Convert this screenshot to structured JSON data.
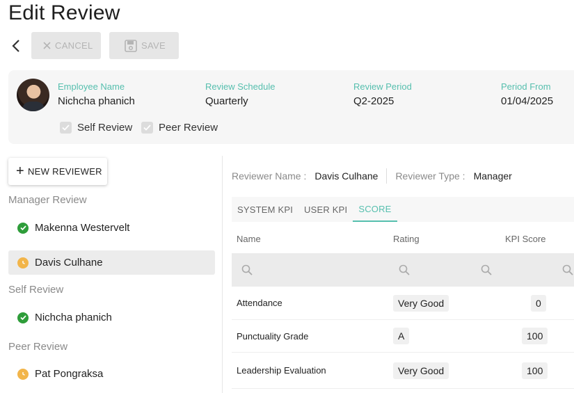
{
  "page": {
    "title": "Edit Review"
  },
  "toolbar": {
    "cancel_label": "CANCEL",
    "save_label": "SAVE"
  },
  "employee": {
    "name_label": "Employee Name",
    "name": "Nichcha phanich",
    "schedule_label": "Review Schedule",
    "schedule": "Quarterly",
    "period_label": "Review Period",
    "period": "Q2-2025",
    "from_label": "Period From",
    "from": "01/04/2025",
    "self_review_label": "Self Review",
    "peer_review_label": "Peer Review"
  },
  "reviewers": {
    "new_button_label": "NEW REVIEWER",
    "groups": [
      {
        "label": "Manager Review",
        "items": [
          {
            "name": "Makenna Westervelt",
            "status": "done"
          },
          {
            "name": "Davis Culhane",
            "status": "pending",
            "selected": true
          }
        ]
      },
      {
        "label": "Self Review",
        "items": [
          {
            "name": "Nichcha phanich",
            "status": "done"
          }
        ]
      },
      {
        "label": "Peer Review",
        "items": [
          {
            "name": "Pat Pongraksa",
            "status": "pending"
          }
        ]
      }
    ]
  },
  "detail": {
    "reviewer_name_label": "Reviewer Name :",
    "reviewer_name": "Davis Culhane",
    "reviewer_type_label": "Reviewer Type :",
    "reviewer_type": "Manager",
    "tabs": [
      "SYSTEM KPI",
      "USER KPI",
      "SCORE"
    ],
    "active_tab": "SCORE",
    "columns": [
      "Name",
      "Rating",
      "KPI Score"
    ],
    "rows": [
      {
        "name": "Attendance",
        "rating": "Very Good",
        "score": "0"
      },
      {
        "name": "Punctuality Grade",
        "rating": "A",
        "score": "100"
      },
      {
        "name": "Leadership Evaluation",
        "rating": "Very Good",
        "score": "100"
      }
    ]
  },
  "colors": {
    "accent": "#56bfae",
    "done": "#2e9d3a",
    "pending": "#f2b54a"
  }
}
